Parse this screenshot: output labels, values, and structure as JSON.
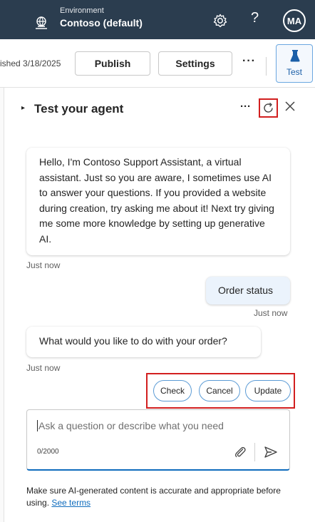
{
  "header": {
    "environment_label": "Environment",
    "environment_name": "Contoso (default)",
    "help_symbol": "?",
    "avatar_initials": "MA",
    "icons": [
      "environment-icon",
      "gear-icon"
    ]
  },
  "toolbar": {
    "published_text": "ished 3/18/2025",
    "publish_label": "Publish",
    "settings_label": "Settings",
    "more_label": "···",
    "test_label": "Test",
    "test_icon": "flask-icon"
  },
  "test_panel": {
    "title": "Test your agent",
    "more_label": "···",
    "icons": [
      "refresh-icon",
      "close-icon",
      "chevron-right-icon"
    ],
    "messages": [
      {
        "from": "bot",
        "text": "Hello, I'm Contoso Support Assistant, a virtual assistant. Just so you are aware, I sometimes use AI to answer your questions. If you provided a website during creation, try asking me about it! Next try giving me some more knowledge by setting up generative AI.",
        "timestamp": "Just now"
      },
      {
        "from": "user",
        "text": "Order status",
        "timestamp": "Just now"
      },
      {
        "from": "bot",
        "text": "What would you like to do with your order?",
        "timestamp": "Just now"
      }
    ],
    "quick_replies": [
      "Check",
      "Cancel",
      "Update"
    ],
    "input": {
      "placeholder": "Ask a question or describe what you need",
      "value": "",
      "counter": "0/2000",
      "icons": [
        "attach-icon",
        "send-icon"
      ]
    },
    "disclaimer_text": "Make sure AI-generated content is accurate and appropriate before using.",
    "see_terms_label": "See terms"
  },
  "colors": {
    "header_bg": "#2b3d4f",
    "accent": "#0f6cbd",
    "highlight": "#d21f1f",
    "user_bubble": "#ebf3fc"
  }
}
